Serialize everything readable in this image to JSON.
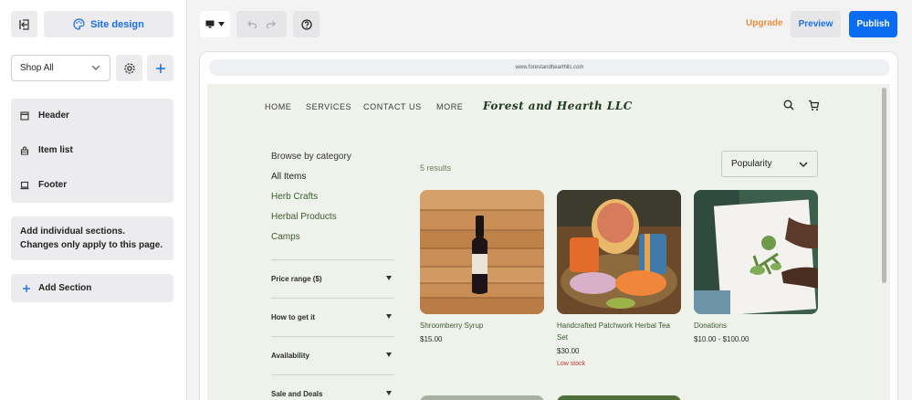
{
  "left_panel": {
    "site_design_label": "Site design",
    "page_select": "Shop All",
    "sections": [
      {
        "label": "Header",
        "icon": "header-icon"
      },
      {
        "label": "Item list",
        "icon": "shop-icon"
      },
      {
        "label": "Footer",
        "icon": "footer-icon"
      }
    ],
    "note": "Add individual sections. Changes only apply to this page.",
    "add_section_label": "Add Section"
  },
  "toolbar": {
    "upgrade_label": "Upgrade",
    "preview_label": "Preview",
    "publish_label": "Publish"
  },
  "browser": {
    "url": "www.forestandhearthllc.com"
  },
  "site": {
    "nav": [
      "HOME",
      "SERVICES",
      "CONTACT US",
      "MORE"
    ],
    "brand": "Forest and Hearth LLC",
    "browse_label": "Browse by category",
    "categories": [
      "All Items",
      "Herb Crafts",
      "Herbal Products",
      "Camps"
    ],
    "filters": [
      "Price range ($)",
      "How to get it",
      "Availability",
      "Sale and Deals"
    ],
    "results_label": "5 results",
    "sort_label": "Popularity",
    "products": [
      {
        "name": "Shroomberry Syrup",
        "price": "$15.00",
        "stock": ""
      },
      {
        "name": "Handcrafted Patchwork Herbal Tea Set",
        "price": "$30.00",
        "stock": "Low stock"
      },
      {
        "name": "Donations",
        "price": "$10.00 - $100.00",
        "stock": ""
      }
    ]
  },
  "colors": {
    "accent": "#0a6cf0",
    "upgrade": "#e8913a",
    "site_background": "#eef2ea",
    "brand_text": "#1f3a1d",
    "low_stock": "#c0392b"
  }
}
